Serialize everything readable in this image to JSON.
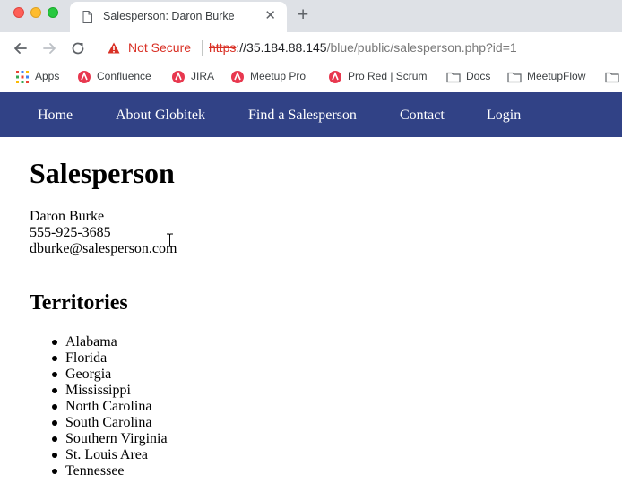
{
  "browser": {
    "tab_title": "Salesperson: Daron Burke",
    "tab_close": "✕",
    "new_tab": "+",
    "security_label": "Not Secure",
    "url_scheme": "https",
    "url_host": "://35.184.88.145",
    "url_path": "/blue/public/salesperson.php?id=1",
    "bookmarks": [
      {
        "label": "Apps",
        "icon": "apps-grid-icon"
      },
      {
        "label": "Confluence",
        "icon": "bookmark-favicon"
      },
      {
        "label": "JIRA",
        "icon": "bookmark-favicon"
      },
      {
        "label": "Meetup Pro",
        "icon": "bookmark-favicon"
      },
      {
        "label": "Pro Red | Scrum",
        "icon": "bookmark-favicon"
      },
      {
        "label": "Docs",
        "icon": "folder-icon"
      },
      {
        "label": "MeetupFlow",
        "icon": "folder-icon"
      }
    ]
  },
  "site_nav": {
    "items": [
      "Home",
      "About Globitek",
      "Find a Salesperson",
      "Contact",
      "Login"
    ],
    "background": "#314286"
  },
  "page": {
    "heading": "Salesperson",
    "name": "Daron Burke",
    "phone": "555-925-3685",
    "email": "dburke@salesperson.com",
    "territories_heading": "Territories",
    "territories": [
      "Alabama",
      "Florida",
      "Georgia",
      "Mississippi",
      "North Carolina",
      "South Carolina",
      "Southern Virginia",
      "St. Louis Area",
      "Tennessee"
    ]
  },
  "colors": {
    "not_secure": "#d93025",
    "nav_bar": "#314286"
  }
}
